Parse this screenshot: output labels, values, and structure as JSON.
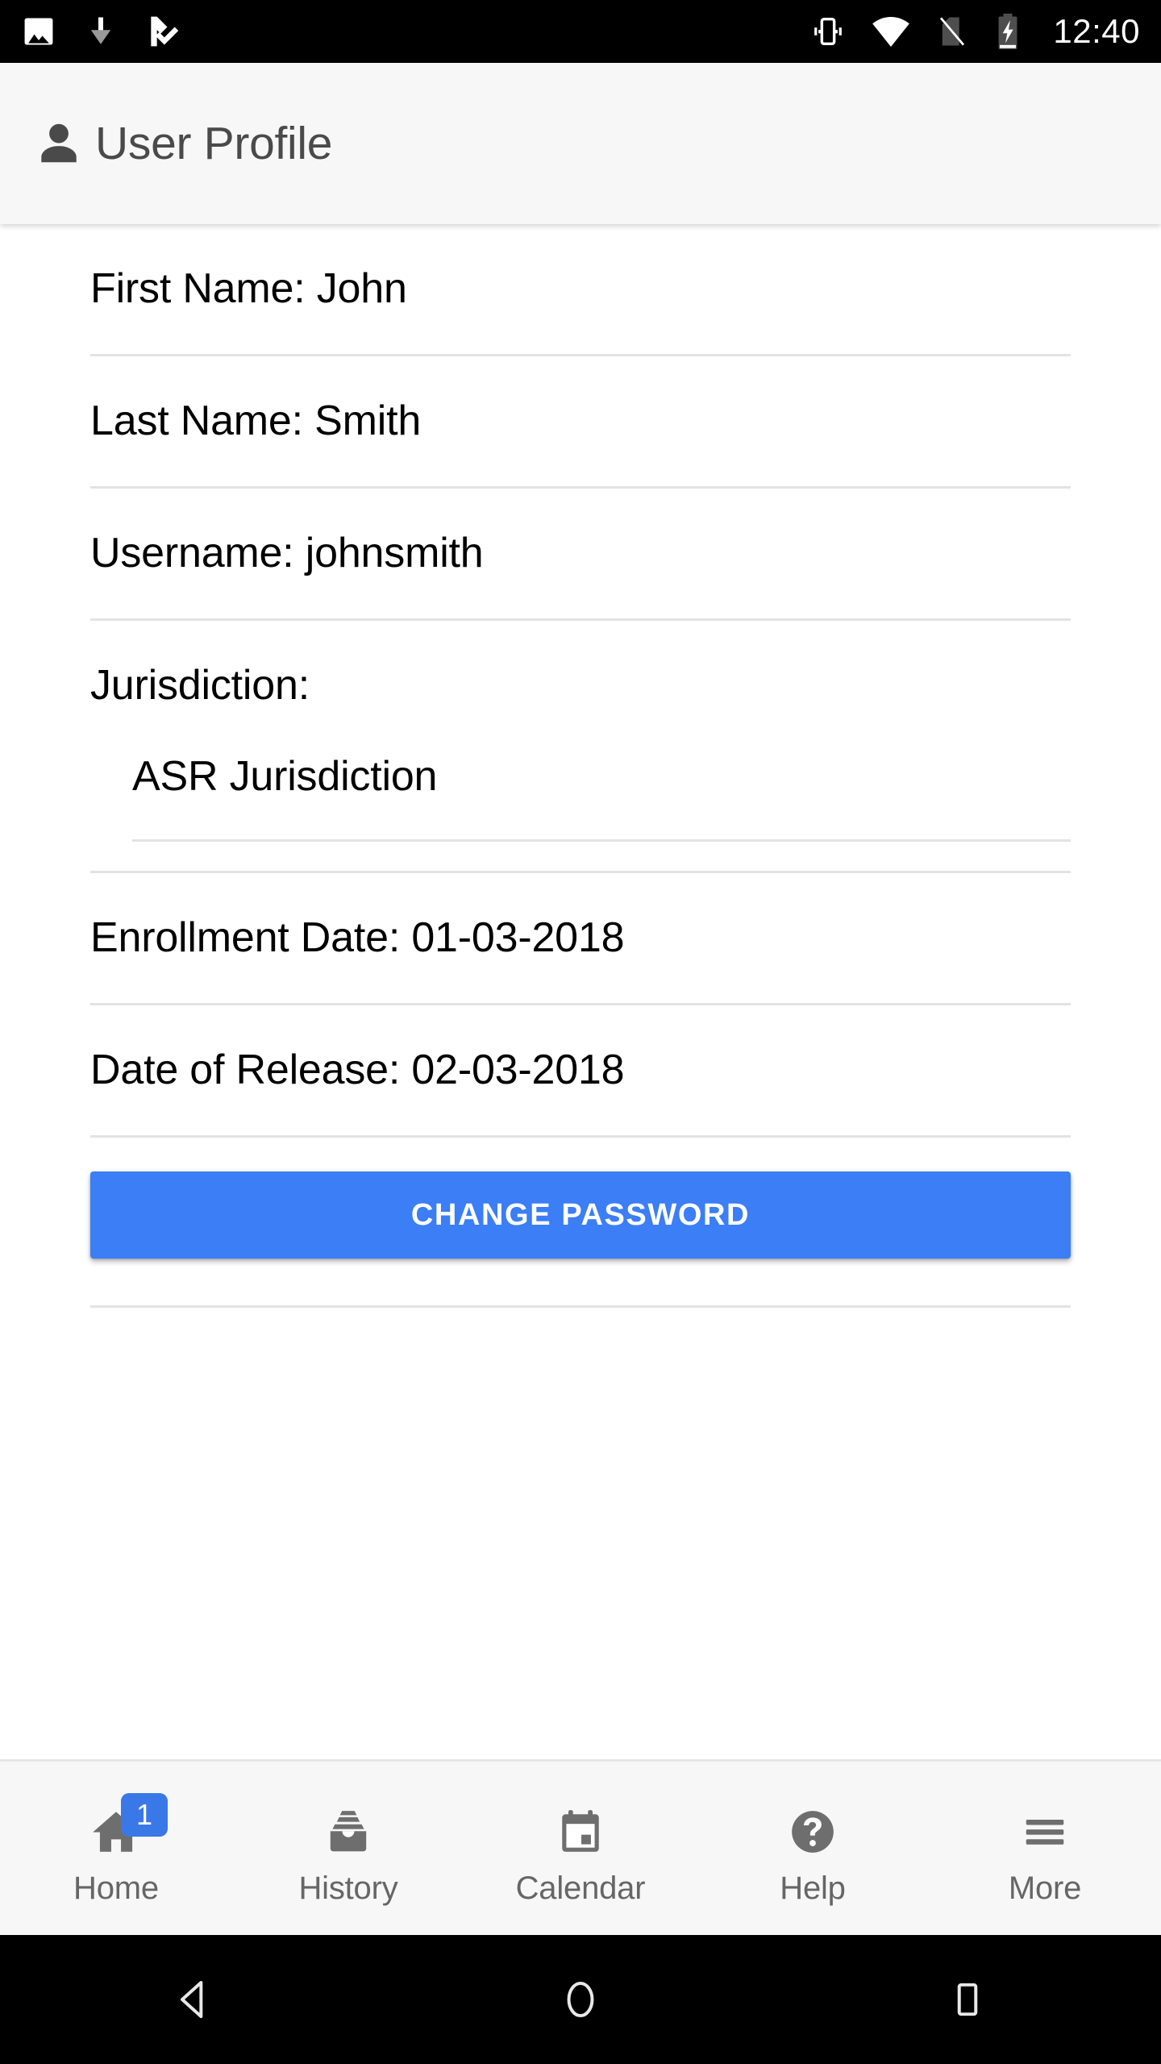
{
  "status_bar": {
    "time": "12:40",
    "left_icons": [
      "image-icon",
      "download-icon",
      "tick-app-icon"
    ],
    "right_icons": [
      "vibrate-icon",
      "wifi-icon",
      "no-sim-icon",
      "battery-charging-icon"
    ],
    "background_color": "#000000",
    "foreground_color": "#ffffff"
  },
  "header": {
    "title": "User Profile",
    "icon": "person-icon",
    "background_color": "#f7f7f7",
    "text_color": "#4a4a4a"
  },
  "profile": {
    "fields": [
      {
        "text": "First Name: John"
      },
      {
        "text": "Last Name: Smith"
      },
      {
        "text": "Username: johnsmith"
      }
    ],
    "jurisdiction": {
      "label": "Jurisdiction:",
      "value": "ASR Jurisdiction"
    },
    "dates": [
      {
        "text": "Enrollment Date: 01-03-2018"
      },
      {
        "text": "Date of Release: 02-03-2018"
      }
    ]
  },
  "actions": {
    "change_password_label": "CHANGE PASSWORD",
    "change_password_color": "#3b7ef5"
  },
  "bottom_nav": {
    "background_color": "#f7f7f7",
    "label_color": "#666666",
    "badge_color": "#3b78e7",
    "items": [
      {
        "label": "Home",
        "icon": "home-icon",
        "badge": "1"
      },
      {
        "label": "History",
        "icon": "archive-icon",
        "badge": null
      },
      {
        "label": "Calendar",
        "icon": "calendar-icon",
        "badge": null
      },
      {
        "label": "Help",
        "icon": "help-circle-icon",
        "badge": null
      },
      {
        "label": "More",
        "icon": "hamburger-menu-icon",
        "badge": null
      }
    ]
  },
  "android_nav": {
    "back": "back-triangle-icon",
    "home": "home-circle-icon",
    "recents": "recents-square-icon"
  }
}
